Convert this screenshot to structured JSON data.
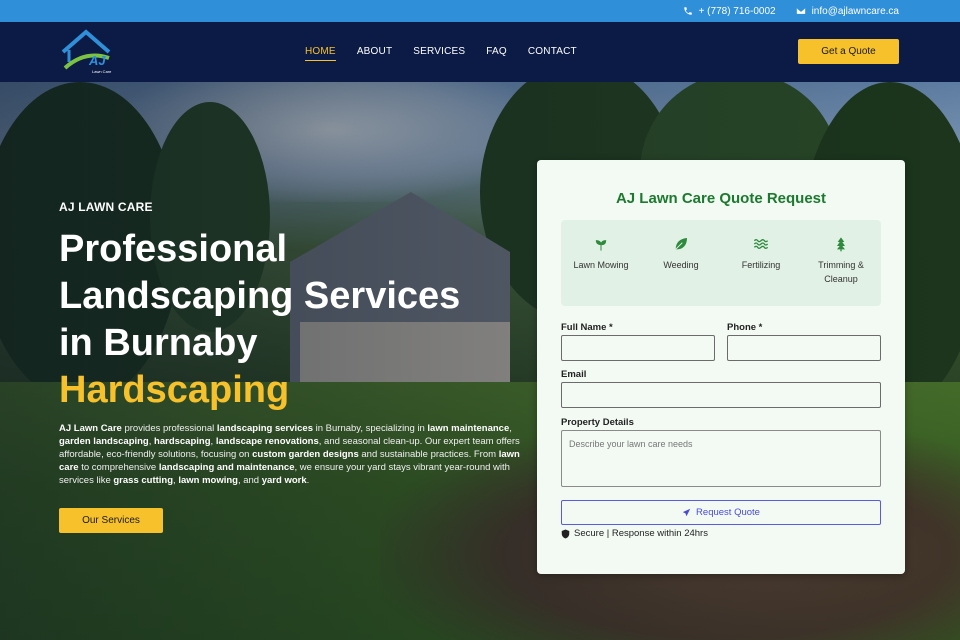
{
  "topbar": {
    "phone": "+ (778) 716-0002",
    "email": "info@ajlawncare.ca"
  },
  "header": {
    "logo_text": "AJ",
    "logo_subtext": "Lawn Care",
    "nav": [
      {
        "label": "HOME",
        "active": true
      },
      {
        "label": "ABOUT",
        "active": false
      },
      {
        "label": "SERVICES",
        "active": false
      },
      {
        "label": "FAQ",
        "active": false
      },
      {
        "label": "CONTACT",
        "active": false
      }
    ],
    "cta_label": "Get a Quote"
  },
  "hero": {
    "eyebrow": "AJ LAWN CARE",
    "headline_line1": "Professional",
    "headline_line2": "Landscaping Services",
    "headline_line3": "in Burnaby",
    "headline_accent": "Hardscaping",
    "description": [
      {
        "text": "AJ Lawn Care",
        "bold": true
      },
      {
        "text": " provides professional ",
        "bold": false
      },
      {
        "text": "landscaping services",
        "bold": true
      },
      {
        "text": " in Burnaby, specializing in ",
        "bold": false
      },
      {
        "text": "lawn maintenance",
        "bold": true
      },
      {
        "text": ", ",
        "bold": false
      },
      {
        "text": "garden landscaping",
        "bold": true
      },
      {
        "text": ", ",
        "bold": false
      },
      {
        "text": "hardscaping",
        "bold": true
      },
      {
        "text": ", ",
        "bold": false
      },
      {
        "text": "landscape renovations",
        "bold": true
      },
      {
        "text": ", and seasonal clean-up. Our expert team offers affordable, eco-friendly solutions, focusing on ",
        "bold": false
      },
      {
        "text": "custom garden designs",
        "bold": true
      },
      {
        "text": " and sustainable practices. From ",
        "bold": false
      },
      {
        "text": "lawn care",
        "bold": true
      },
      {
        "text": " to comprehensive ",
        "bold": false
      },
      {
        "text": "landscaping and maintenance",
        "bold": true
      },
      {
        "text": ", we ensure your yard stays vibrant year-round with services like ",
        "bold": false
      },
      {
        "text": "grass cutting",
        "bold": true
      },
      {
        "text": ", ",
        "bold": false
      },
      {
        "text": "lawn mowing",
        "bold": true
      },
      {
        "text": ", and ",
        "bold": false
      },
      {
        "text": "yard work",
        "bold": true
      },
      {
        "text": ".",
        "bold": false
      }
    ],
    "services_button": "Our Services"
  },
  "form": {
    "title": "AJ Lawn Care Quote Request",
    "services": [
      {
        "label": "Lawn Mowing",
        "icon": "seedling-icon"
      },
      {
        "label": "Weeding",
        "icon": "leaf-icon"
      },
      {
        "label": "Fertilizing",
        "icon": "water-icon"
      },
      {
        "label": "Trimming & Cleanup",
        "icon": "tree-icon"
      }
    ],
    "full_name_label": "Full Name *",
    "full_name_value": "",
    "phone_label": "Phone *",
    "phone_value": "",
    "email_label": "Email",
    "email_value": "",
    "property_label": "Property Details",
    "property_placeholder": "Describe your lawn care needs",
    "submit_label": "Request Quote",
    "secure_text": "Secure | Response within 24hrs"
  },
  "colors": {
    "accent": "#f6c12b",
    "topbar": "#2f8fd9",
    "header": "#0c1b45",
    "form_title": "#1c7a2e"
  }
}
